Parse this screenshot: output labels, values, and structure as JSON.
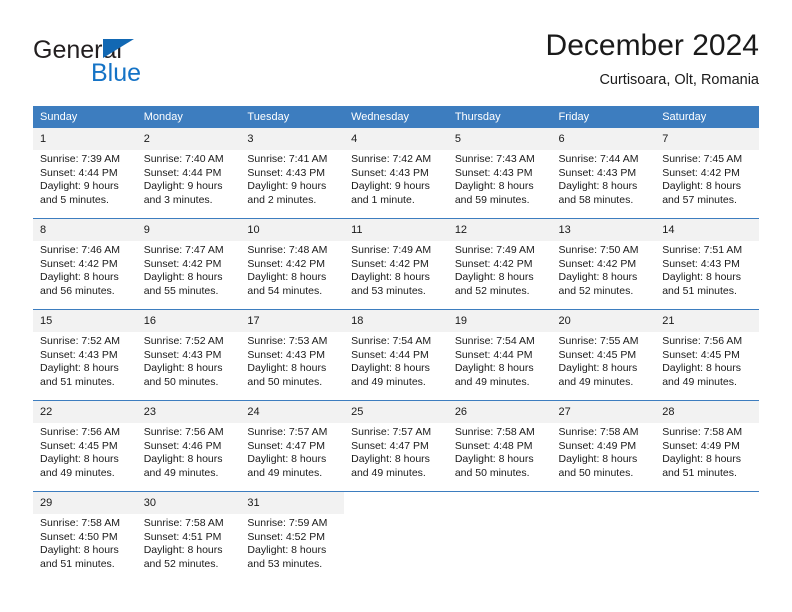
{
  "brand": {
    "name_part1": "General",
    "name_part2": "Blue",
    "logo_icon": "triangle-flag-icon"
  },
  "header": {
    "title": "December 2024",
    "subtitle": "Curtisoara, Olt, Romania"
  },
  "colors": {
    "header_blue": "#3d7dbf",
    "brand_blue": "#1573c6",
    "daynum_bg": "#f2f2f2",
    "text": "#1a1a1a"
  },
  "weekdays": [
    "Sunday",
    "Monday",
    "Tuesday",
    "Wednesday",
    "Thursday",
    "Friday",
    "Saturday"
  ],
  "weeks": [
    [
      {
        "day": "1",
        "sunrise": "Sunrise: 7:39 AM",
        "sunset": "Sunset: 4:44 PM",
        "daylight1": "Daylight: 9 hours",
        "daylight2": "and 5 minutes."
      },
      {
        "day": "2",
        "sunrise": "Sunrise: 7:40 AM",
        "sunset": "Sunset: 4:44 PM",
        "daylight1": "Daylight: 9 hours",
        "daylight2": "and 3 minutes."
      },
      {
        "day": "3",
        "sunrise": "Sunrise: 7:41 AM",
        "sunset": "Sunset: 4:43 PM",
        "daylight1": "Daylight: 9 hours",
        "daylight2": "and 2 minutes."
      },
      {
        "day": "4",
        "sunrise": "Sunrise: 7:42 AM",
        "sunset": "Sunset: 4:43 PM",
        "daylight1": "Daylight: 9 hours",
        "daylight2": "and 1 minute."
      },
      {
        "day": "5",
        "sunrise": "Sunrise: 7:43 AM",
        "sunset": "Sunset: 4:43 PM",
        "daylight1": "Daylight: 8 hours",
        "daylight2": "and 59 minutes."
      },
      {
        "day": "6",
        "sunrise": "Sunrise: 7:44 AM",
        "sunset": "Sunset: 4:43 PM",
        "daylight1": "Daylight: 8 hours",
        "daylight2": "and 58 minutes."
      },
      {
        "day": "7",
        "sunrise": "Sunrise: 7:45 AM",
        "sunset": "Sunset: 4:42 PM",
        "daylight1": "Daylight: 8 hours",
        "daylight2": "and 57 minutes."
      }
    ],
    [
      {
        "day": "8",
        "sunrise": "Sunrise: 7:46 AM",
        "sunset": "Sunset: 4:42 PM",
        "daylight1": "Daylight: 8 hours",
        "daylight2": "and 56 minutes."
      },
      {
        "day": "9",
        "sunrise": "Sunrise: 7:47 AM",
        "sunset": "Sunset: 4:42 PM",
        "daylight1": "Daylight: 8 hours",
        "daylight2": "and 55 minutes."
      },
      {
        "day": "10",
        "sunrise": "Sunrise: 7:48 AM",
        "sunset": "Sunset: 4:42 PM",
        "daylight1": "Daylight: 8 hours",
        "daylight2": "and 54 minutes."
      },
      {
        "day": "11",
        "sunrise": "Sunrise: 7:49 AM",
        "sunset": "Sunset: 4:42 PM",
        "daylight1": "Daylight: 8 hours",
        "daylight2": "and 53 minutes."
      },
      {
        "day": "12",
        "sunrise": "Sunrise: 7:49 AM",
        "sunset": "Sunset: 4:42 PM",
        "daylight1": "Daylight: 8 hours",
        "daylight2": "and 52 minutes."
      },
      {
        "day": "13",
        "sunrise": "Sunrise: 7:50 AM",
        "sunset": "Sunset: 4:42 PM",
        "daylight1": "Daylight: 8 hours",
        "daylight2": "and 52 minutes."
      },
      {
        "day": "14",
        "sunrise": "Sunrise: 7:51 AM",
        "sunset": "Sunset: 4:43 PM",
        "daylight1": "Daylight: 8 hours",
        "daylight2": "and 51 minutes."
      }
    ],
    [
      {
        "day": "15",
        "sunrise": "Sunrise: 7:52 AM",
        "sunset": "Sunset: 4:43 PM",
        "daylight1": "Daylight: 8 hours",
        "daylight2": "and 51 minutes."
      },
      {
        "day": "16",
        "sunrise": "Sunrise: 7:52 AM",
        "sunset": "Sunset: 4:43 PM",
        "daylight1": "Daylight: 8 hours",
        "daylight2": "and 50 minutes."
      },
      {
        "day": "17",
        "sunrise": "Sunrise: 7:53 AM",
        "sunset": "Sunset: 4:43 PM",
        "daylight1": "Daylight: 8 hours",
        "daylight2": "and 50 minutes."
      },
      {
        "day": "18",
        "sunrise": "Sunrise: 7:54 AM",
        "sunset": "Sunset: 4:44 PM",
        "daylight1": "Daylight: 8 hours",
        "daylight2": "and 49 minutes."
      },
      {
        "day": "19",
        "sunrise": "Sunrise: 7:54 AM",
        "sunset": "Sunset: 4:44 PM",
        "daylight1": "Daylight: 8 hours",
        "daylight2": "and 49 minutes."
      },
      {
        "day": "20",
        "sunrise": "Sunrise: 7:55 AM",
        "sunset": "Sunset: 4:45 PM",
        "daylight1": "Daylight: 8 hours",
        "daylight2": "and 49 minutes."
      },
      {
        "day": "21",
        "sunrise": "Sunrise: 7:56 AM",
        "sunset": "Sunset: 4:45 PM",
        "daylight1": "Daylight: 8 hours",
        "daylight2": "and 49 minutes."
      }
    ],
    [
      {
        "day": "22",
        "sunrise": "Sunrise: 7:56 AM",
        "sunset": "Sunset: 4:45 PM",
        "daylight1": "Daylight: 8 hours",
        "daylight2": "and 49 minutes."
      },
      {
        "day": "23",
        "sunrise": "Sunrise: 7:56 AM",
        "sunset": "Sunset: 4:46 PM",
        "daylight1": "Daylight: 8 hours",
        "daylight2": "and 49 minutes."
      },
      {
        "day": "24",
        "sunrise": "Sunrise: 7:57 AM",
        "sunset": "Sunset: 4:47 PM",
        "daylight1": "Daylight: 8 hours",
        "daylight2": "and 49 minutes."
      },
      {
        "day": "25",
        "sunrise": "Sunrise: 7:57 AM",
        "sunset": "Sunset: 4:47 PM",
        "daylight1": "Daylight: 8 hours",
        "daylight2": "and 49 minutes."
      },
      {
        "day": "26",
        "sunrise": "Sunrise: 7:58 AM",
        "sunset": "Sunset: 4:48 PM",
        "daylight1": "Daylight: 8 hours",
        "daylight2": "and 50 minutes."
      },
      {
        "day": "27",
        "sunrise": "Sunrise: 7:58 AM",
        "sunset": "Sunset: 4:49 PM",
        "daylight1": "Daylight: 8 hours",
        "daylight2": "and 50 minutes."
      },
      {
        "day": "28",
        "sunrise": "Sunrise: 7:58 AM",
        "sunset": "Sunset: 4:49 PM",
        "daylight1": "Daylight: 8 hours",
        "daylight2": "and 51 minutes."
      }
    ],
    [
      {
        "day": "29",
        "sunrise": "Sunrise: 7:58 AM",
        "sunset": "Sunset: 4:50 PM",
        "daylight1": "Daylight: 8 hours",
        "daylight2": "and 51 minutes."
      },
      {
        "day": "30",
        "sunrise": "Sunrise: 7:58 AM",
        "sunset": "Sunset: 4:51 PM",
        "daylight1": "Daylight: 8 hours",
        "daylight2": "and 52 minutes."
      },
      {
        "day": "31",
        "sunrise": "Sunrise: 7:59 AM",
        "sunset": "Sunset: 4:52 PM",
        "daylight1": "Daylight: 8 hours",
        "daylight2": "and 53 minutes."
      },
      {
        "day": "",
        "sunrise": "",
        "sunset": "",
        "daylight1": "",
        "daylight2": ""
      },
      {
        "day": "",
        "sunrise": "",
        "sunset": "",
        "daylight1": "",
        "daylight2": ""
      },
      {
        "day": "",
        "sunrise": "",
        "sunset": "",
        "daylight1": "",
        "daylight2": ""
      },
      {
        "day": "",
        "sunrise": "",
        "sunset": "",
        "daylight1": "",
        "daylight2": ""
      }
    ]
  ]
}
